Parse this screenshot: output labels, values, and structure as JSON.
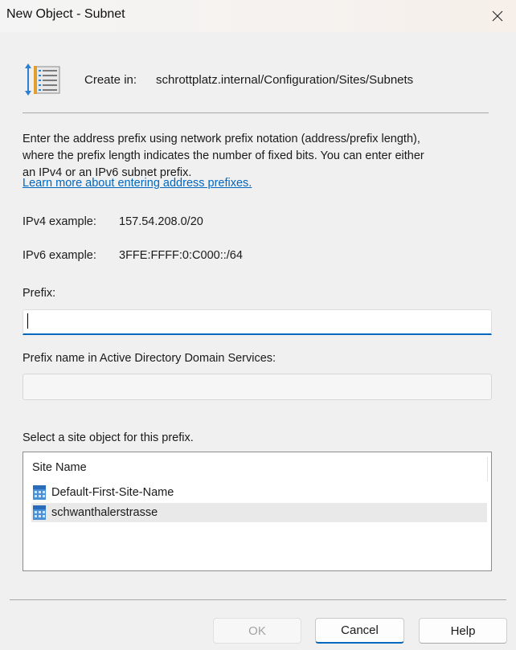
{
  "window": {
    "title": "New Object - Subnet"
  },
  "header": {
    "create_in_label": "Create in:",
    "create_in_path": "schrottplatz.internal/Configuration/Sites/Subnets"
  },
  "description": {
    "text": "Enter the address prefix using network prefix notation (address/prefix length), where the prefix length indicates the number of fixed bits. You can enter either an IPv4 or an IPv6 subnet prefix.",
    "link": "Learn more about entering address prefixes."
  },
  "examples": {
    "ipv4_label": "IPv4 example:",
    "ipv4_value": "157.54.208.0/20",
    "ipv6_label": "IPv6 example:",
    "ipv6_value": "3FFE:FFFF:0:C000::/64"
  },
  "prefix": {
    "label": "Prefix:",
    "value": ""
  },
  "prefix_name": {
    "label": "Prefix name in Active Directory Domain Services:",
    "value": ""
  },
  "site_select": {
    "label": "Select a site object for this prefix.",
    "column_header": "Site Name",
    "items": [
      {
        "name": "Default-First-Site-Name",
        "selected": false
      },
      {
        "name": "schwanthalerstrasse",
        "selected": true
      }
    ]
  },
  "buttons": {
    "ok": "OK",
    "cancel": "Cancel",
    "help": "Help"
  },
  "colors": {
    "accent": "#0067c0",
    "disabled_text": "#a3a3a3"
  }
}
